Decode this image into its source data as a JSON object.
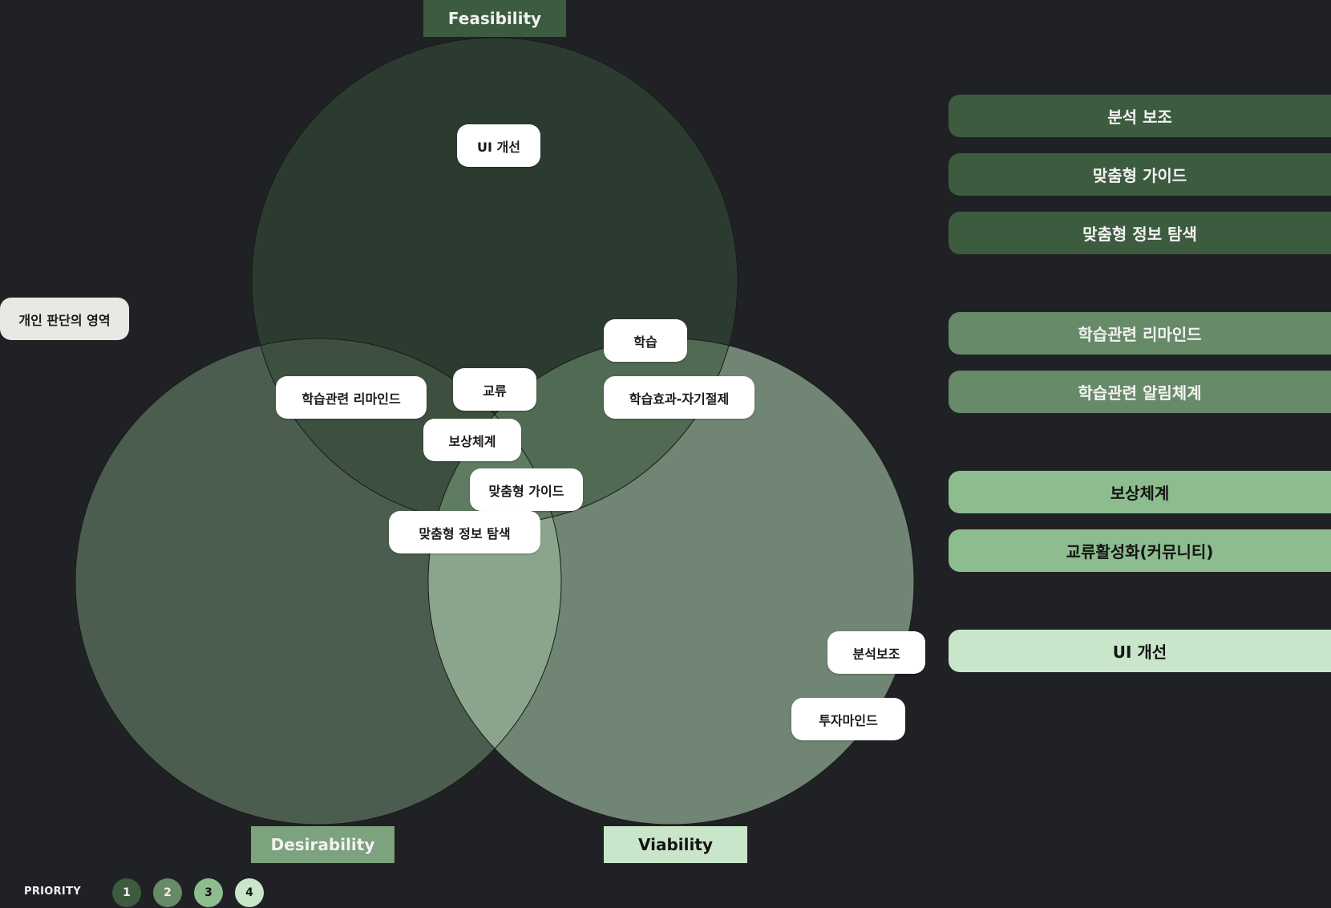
{
  "axes": {
    "feasibility": "Feasibility",
    "desirability": "Desirability",
    "viability": "Viability"
  },
  "colors": {
    "background": "#202124",
    "priority_1": "#3d5b3f",
    "priority_2": "#678a68",
    "priority_3": "#8dbd8f",
    "priority_4": "#c9e6ca",
    "circle_feasibility": "#2c3b2f",
    "circle_desirability": "#4c5f4f",
    "circle_viability": "#748877"
  },
  "outside_label": "개인 판단의 영역",
  "chips": {
    "ui_improve": "UI 개선",
    "learning": "학습",
    "learning_reminder": "학습관련 리마인드",
    "exchange": "교류",
    "learning_effect": "학습효과-자기절제",
    "reward": "보상체계",
    "custom_guide": "맞춤형 가이드",
    "custom_search": "맞춤형 정보 탐색",
    "analysis_support": "분석보조",
    "investment_mind": "투자마인드"
  },
  "legend": {
    "items": [
      {
        "label": "분석 보조",
        "priority": 1
      },
      {
        "label": "맞춤형 가이드",
        "priority": 1
      },
      {
        "label": "맞춤형 정보 탐색",
        "priority": 1
      },
      {
        "label": "학습관련 리마인드",
        "priority": 2
      },
      {
        "label": "학습관련 알림체계",
        "priority": 2
      },
      {
        "label": "보상체계",
        "priority": 3
      },
      {
        "label": "교류활성화(커뮤니티)",
        "priority": 3
      },
      {
        "label": "UI 개선",
        "priority": 4
      }
    ]
  },
  "priority": {
    "label": "PRIORITY",
    "levels": [
      "1",
      "2",
      "3",
      "4"
    ]
  }
}
